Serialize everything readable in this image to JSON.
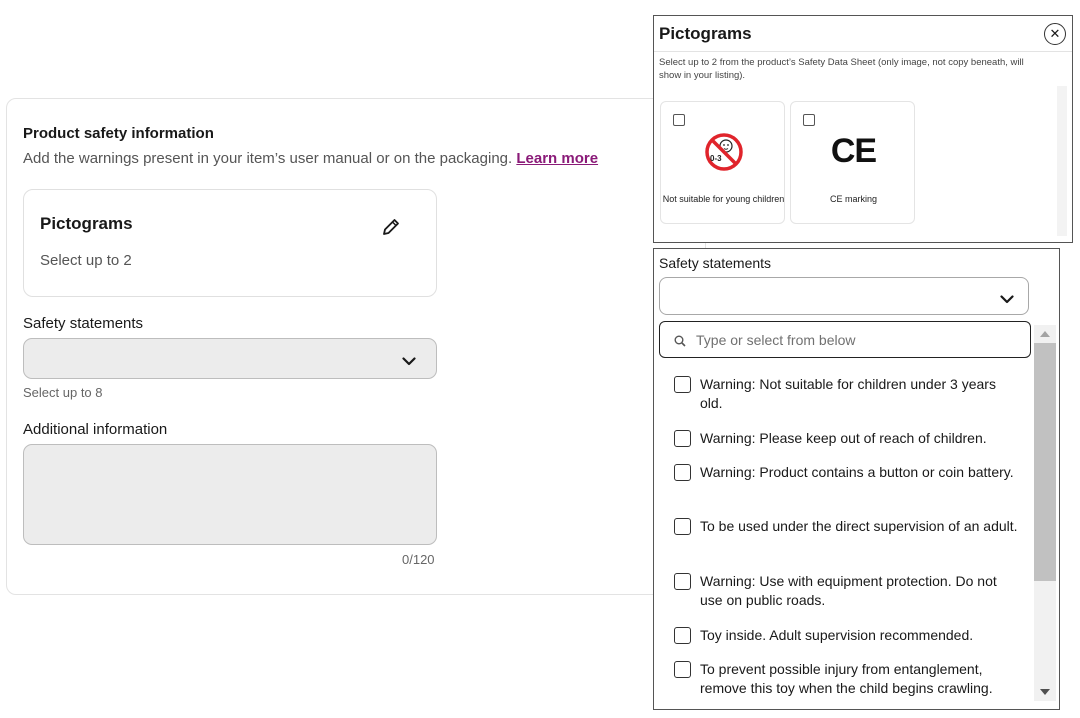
{
  "product_safety": {
    "title": "Product safety information",
    "subtitle": "Add the warnings present in your item’s user manual or on the packaging.",
    "learn_more": "Learn more",
    "pictograms": {
      "title": "Pictograms",
      "subtitle": "Select up to 2",
      "edit_icon": "pencil-icon"
    },
    "safety_statements": {
      "label": "Safety statements",
      "value": "",
      "hint": "Select up to 8",
      "chevron_icon": "chevron-down-icon"
    },
    "additional_info": {
      "label": "Additional information",
      "value": "",
      "counter": "0/120"
    }
  },
  "pictogram_popup": {
    "title": "Pictograms",
    "close_icon": "close-icon",
    "description": "Select up to 2 from the product’s Safety Data Sheet (only image, not copy beneath, will show in your listing).",
    "options": [
      {
        "label": "Not suitable for young children",
        "icon": "not-for-young-children-icon",
        "badge": "0-3",
        "checked": false
      },
      {
        "label": "CE marking",
        "icon": "ce-marking-icon",
        "mark": "CE",
        "checked": false
      }
    ]
  },
  "statements_popup": {
    "label": "Safety statements",
    "selected": "",
    "search_placeholder": "Type or select from below",
    "search_icon": "search-icon",
    "items": [
      {
        "text": "Warning: Not suitable for children under 3 years old.",
        "checked": false
      },
      {
        "text": "Warning: Please keep out of reach of children.",
        "checked": false
      },
      {
        "text": "Warning: Product contains a button or coin battery.",
        "checked": false
      },
      {
        "text": "To be used under the direct supervision of an adult.",
        "checked": false
      },
      {
        "text": "Warning: Use with equipment protection. Do not use on public roads.",
        "checked": false
      },
      {
        "text": "Toy inside. Adult supervision recommended.",
        "checked": false
      },
      {
        "text": "To prevent possible injury from entanglement, remove this toy when the child begins crawling.",
        "checked": false
      }
    ]
  },
  "colors": {
    "link": "#8a1a78",
    "arrow": "#e0242b",
    "field_bg": "#ececec"
  }
}
